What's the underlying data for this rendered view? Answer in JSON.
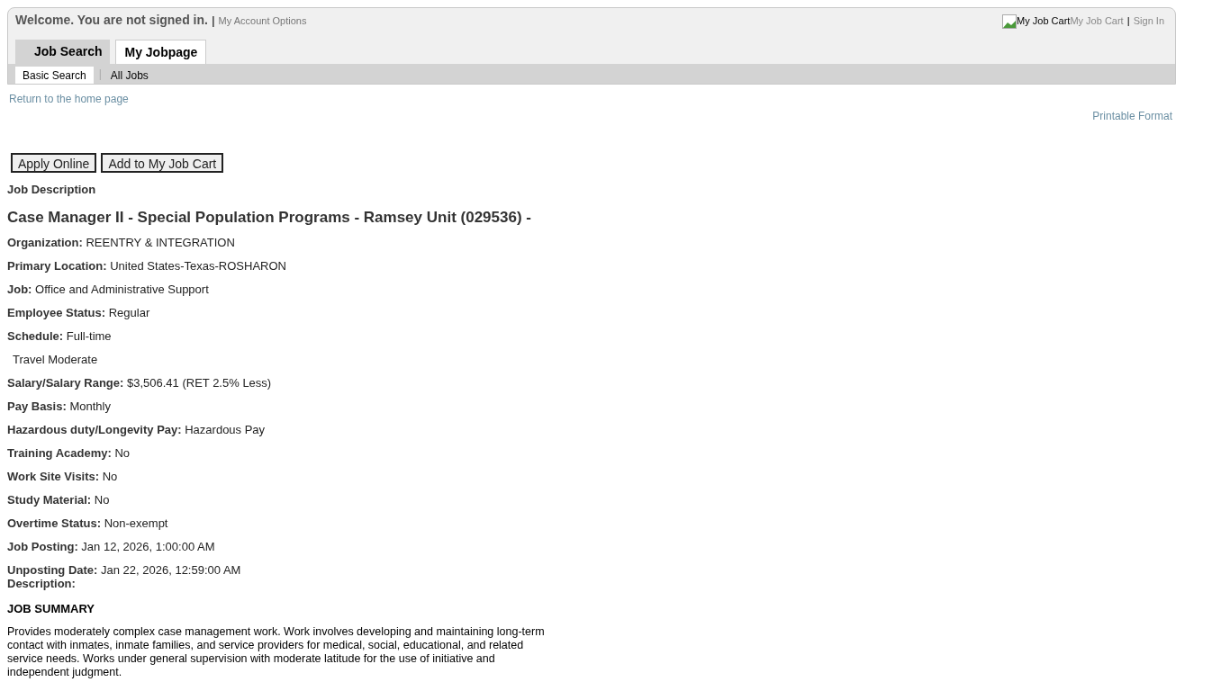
{
  "header": {
    "welcome": "Welcome. You are not signed in.",
    "separator": "|",
    "account_link": "My Account Options",
    "cart_image_alt": "My Job Cart",
    "cart_link": "My Job Cart",
    "signin_separator": "|",
    "signin_link": "Sign In"
  },
  "tabs": [
    {
      "label": "Job Search",
      "selected": false
    },
    {
      "label": "My Jobpage",
      "selected": true
    }
  ],
  "subtabs": [
    {
      "label": "Basic Search",
      "selected": true
    },
    {
      "label": "All Jobs",
      "selected": false
    }
  ],
  "subtab_separator": "|",
  "home_link": "Return to the home page",
  "printable_link": "Printable Format",
  "buttons": [
    "Apply Online",
    "Add to My Job Cart"
  ],
  "section_label": "Job Description",
  "job_title": "Case Manager II - Special Population Programs - Ramsey Unit (029536) -",
  "fields": [
    {
      "kind": "labeled",
      "label": "Organization:",
      "value": "REENTRY & INTEGRATION"
    },
    {
      "kind": "labeled",
      "label": "Primary Location:",
      "value": "United States-Texas-ROSHARON"
    },
    {
      "kind": "labeled",
      "label": "Job:",
      "value": "Office and Administrative Support"
    },
    {
      "kind": "labeled",
      "label": "Employee Status:",
      "value": "Regular"
    },
    {
      "kind": "labeled",
      "label": "Schedule:",
      "value": "Full-time"
    },
    {
      "kind": "plain",
      "value": "Travel Moderate"
    },
    {
      "kind": "labeled",
      "label": "Salary/Salary Range:",
      "value": "$3,506.41 (RET 2.5% Less)"
    },
    {
      "kind": "labeled",
      "label": "Pay Basis:",
      "value": "Monthly"
    },
    {
      "kind": "labeled",
      "label": "Hazardous duty/Longevity Pay:",
      "value": "Hazardous Pay"
    },
    {
      "kind": "labeled",
      "label": "Training Academy:",
      "value": "No"
    },
    {
      "kind": "labeled",
      "label": "Work Site Visits:",
      "value": "No"
    },
    {
      "kind": "labeled",
      "label": "Study Material:",
      "value": "No"
    },
    {
      "kind": "labeled",
      "label": "Overtime Status:",
      "value": "Non-exempt"
    },
    {
      "kind": "labeled",
      "label": "Job Posting:",
      "value": "Jan 12, 2026, 1:00:00 AM"
    },
    {
      "kind": "labeled",
      "label": "Unposting Date:",
      "value": "Jan 22, 2026, 12:59:00 AM"
    }
  ],
  "description_label": "Description:",
  "summary_heading": "JOB SUMMARY",
  "summary_text": "Provides moderately complex case management work. Work involves developing and maintaining long-term contact with inmates, inmate families, and service providers for medical, social, educational, and related service needs. Works under general supervision with moderate latitude for the use of initiative and independent judgment."
}
